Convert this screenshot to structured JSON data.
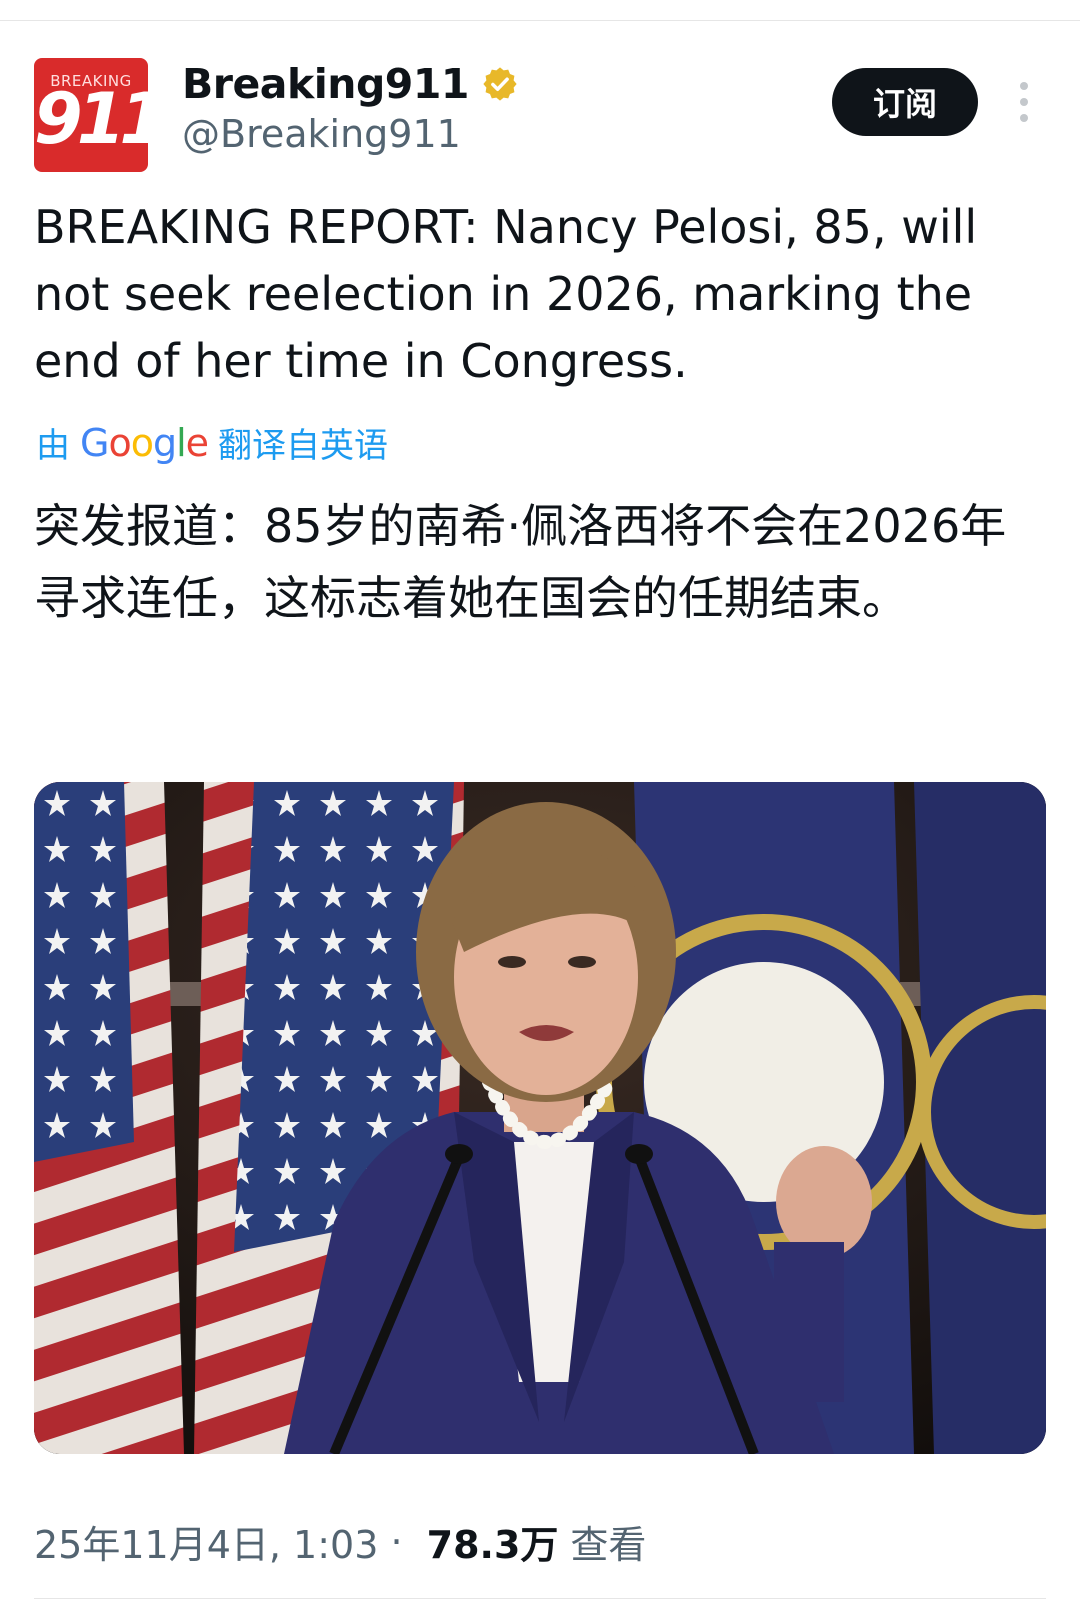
{
  "account": {
    "avatar_small_text": "BREAKING",
    "avatar_big_text": "911",
    "display_name": "Breaking911",
    "handle": "@Breaking911",
    "verified_icon": "verified-badge-gold"
  },
  "actions": {
    "subscribe_label": "订阅",
    "more_icon": "more-vertical-icon"
  },
  "tweet": {
    "text": "BREAKING REPORT: Nancy Pelosi, 85, will not seek reelection in 2026, marking the end of her time in Congress.",
    "translation_prefix": "由",
    "translation_provider": "Google",
    "translation_suffix": "翻译自英语",
    "translated_text": "突发报道：85岁的南希·佩洛西将不会在2026年寻求连任，这标志着她在国会的任期结束。",
    "timestamp": "25年11月4日, 1:03",
    "separator": " · ",
    "views_count": "78.3万",
    "views_label": "查看"
  },
  "colors": {
    "brand_red": "#d92b2b",
    "link_blue": "#1d9bf0",
    "text_primary": "#0f1419",
    "text_secondary": "#536471",
    "verified_gold": "#e8b829"
  }
}
